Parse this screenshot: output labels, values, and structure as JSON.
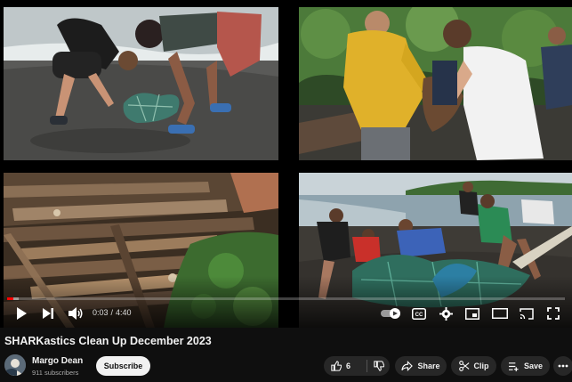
{
  "player": {
    "current_time": "0:03",
    "duration": "4:40",
    "progress": 0.011,
    "loaded": 0.02
  },
  "video": {
    "title": "SHARKastics Clean Up December 2023"
  },
  "channel": {
    "name": "Margo Dean",
    "subscribers": "911 subscribers",
    "subscribe_label": "Subscribe"
  },
  "actions": {
    "likes": "6",
    "share_label": "Share",
    "clip_label": "Clip",
    "save_label": "Save"
  },
  "icons": {
    "play": "play-icon",
    "next": "next-icon",
    "volume": "volume-icon",
    "autoplay": "autoplay-toggle-icon",
    "captions": "captions-icon",
    "settings": "gear-icon",
    "miniplayer": "miniplayer-icon",
    "theater": "theater-icon",
    "cast": "cast-icon",
    "fullscreen": "fullscreen-icon"
  },
  "colors": {
    "progress": "#ff0000",
    "background": "#0f0f0f",
    "pill": "#272727"
  }
}
